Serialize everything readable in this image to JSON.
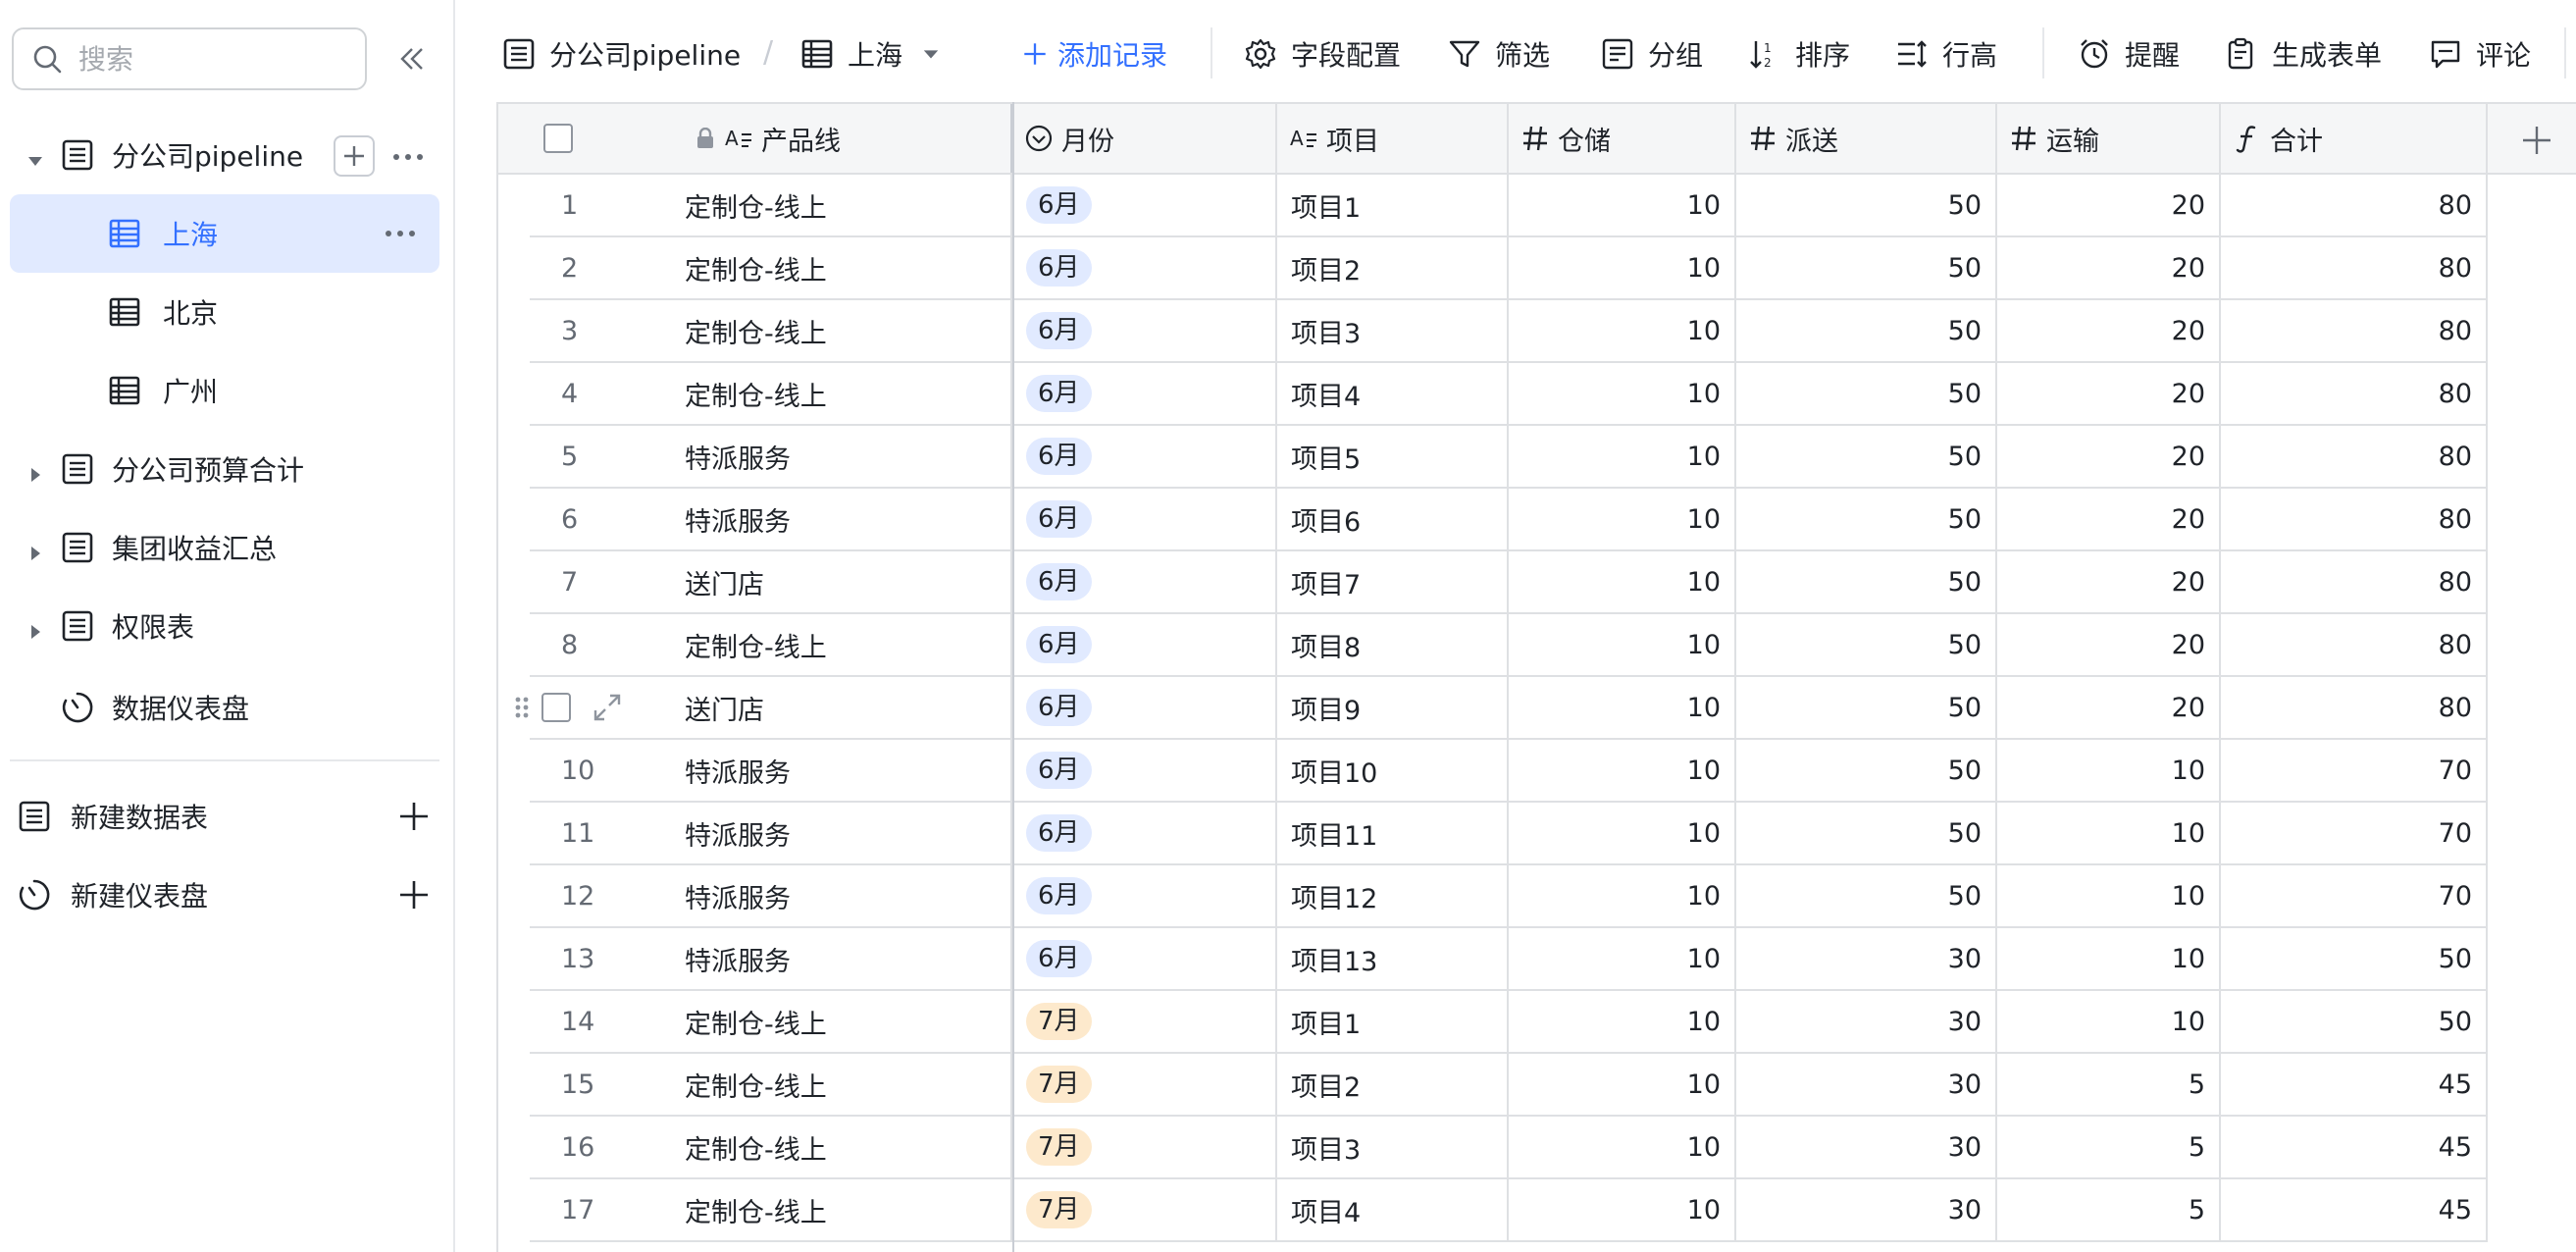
{
  "sidebar": {
    "search_placeholder": "搜索",
    "tree": [
      {
        "label": "分公司pipeline",
        "expanded": true,
        "children": [
          "上海",
          "北京",
          "广州"
        ]
      },
      {
        "label": "分公司预算合计"
      },
      {
        "label": "集团收益汇总"
      },
      {
        "label": "权限表"
      },
      {
        "label": "数据仪表盘"
      }
    ],
    "active_child": "上海",
    "create": [
      {
        "label": "新建数据表"
      },
      {
        "label": "新建仪表盘"
      }
    ]
  },
  "toolbar": {
    "base_title": "分公司pipeline",
    "view_name": "上海",
    "add_record": "添加记录",
    "field_config": "字段配置",
    "filter": "筛选",
    "group": "分组",
    "sort": "排序",
    "row_height": "行高",
    "remind": "提醒",
    "gen_form": "生成表单",
    "comment": "评论"
  },
  "table": {
    "columns": [
      "产品线",
      "月份",
      "项目",
      "仓储",
      "派送",
      "运输",
      "合计"
    ],
    "rows": [
      {
        "id": "1",
        "line": "定制仓-线上",
        "month": "6月",
        "project": "项目1",
        "storage": "10",
        "delivery": "50",
        "transport": "20",
        "total": "80"
      },
      {
        "id": "2",
        "line": "定制仓-线上",
        "month": "6月",
        "project": "项目2",
        "storage": "10",
        "delivery": "50",
        "transport": "20",
        "total": "80"
      },
      {
        "id": "3",
        "line": "定制仓-线上",
        "month": "6月",
        "project": "项目3",
        "storage": "10",
        "delivery": "50",
        "transport": "20",
        "total": "80"
      },
      {
        "id": "4",
        "line": "定制仓-线上",
        "month": "6月",
        "project": "项目4",
        "storage": "10",
        "delivery": "50",
        "transport": "20",
        "total": "80"
      },
      {
        "id": "5",
        "line": "特派服务",
        "month": "6月",
        "project": "项目5",
        "storage": "10",
        "delivery": "50",
        "transport": "20",
        "total": "80"
      },
      {
        "id": "6",
        "line": "特派服务",
        "month": "6月",
        "project": "项目6",
        "storage": "10",
        "delivery": "50",
        "transport": "20",
        "total": "80"
      },
      {
        "id": "7",
        "line": "送门店",
        "month": "6月",
        "project": "项目7",
        "storage": "10",
        "delivery": "50",
        "transport": "20",
        "total": "80"
      },
      {
        "id": "8",
        "line": "定制仓-线上",
        "month": "6月",
        "project": "项目8",
        "storage": "10",
        "delivery": "50",
        "transport": "20",
        "total": "80"
      },
      {
        "id": "",
        "line": "送门店",
        "month": "6月",
        "project": "项目9",
        "storage": "10",
        "delivery": "50",
        "transport": "20",
        "total": "80",
        "hover": true
      },
      {
        "id": "10",
        "line": "特派服务",
        "month": "6月",
        "project": "项目10",
        "storage": "10",
        "delivery": "50",
        "transport": "10",
        "total": "70"
      },
      {
        "id": "11",
        "line": "特派服务",
        "month": "6月",
        "project": "项目11",
        "storage": "10",
        "delivery": "50",
        "transport": "10",
        "total": "70"
      },
      {
        "id": "12",
        "line": "特派服务",
        "month": "6月",
        "project": "项目12",
        "storage": "10",
        "delivery": "50",
        "transport": "10",
        "total": "70"
      },
      {
        "id": "13",
        "line": "特派服务",
        "month": "6月",
        "project": "项目13",
        "storage": "10",
        "delivery": "30",
        "transport": "10",
        "total": "50"
      },
      {
        "id": "14",
        "line": "定制仓-线上",
        "month": "7月",
        "project": "项目1",
        "storage": "10",
        "delivery": "30",
        "transport": "10",
        "total": "50"
      },
      {
        "id": "15",
        "line": "定制仓-线上",
        "month": "7月",
        "project": "项目2",
        "storage": "10",
        "delivery": "30",
        "transport": "5",
        "total": "45"
      },
      {
        "id": "16",
        "line": "定制仓-线上",
        "month": "7月",
        "project": "项目3",
        "storage": "10",
        "delivery": "30",
        "transport": "5",
        "total": "45"
      },
      {
        "id": "17",
        "line": "定制仓-线上",
        "month": "7月",
        "project": "项目4",
        "storage": "10",
        "delivery": "30",
        "transport": "5",
        "total": "45"
      }
    ]
  },
  "colors": {
    "accent": "#3370ff",
    "active_bg": "#e1eaff",
    "pill_june": "#e1eaff",
    "pill_july": "#fde9cc",
    "header_bg": "#f5f6f7",
    "border": "#dee0e3"
  },
  "icons": {
    "search": "search-icon",
    "collapse": "double-chevron-left-icon",
    "table": "table-icon",
    "dashboard": "dashboard-icon",
    "plus": "plus-icon",
    "more": "more-icon",
    "caret_right": "caret-right-icon",
    "caret_down": "caret-down-icon"
  }
}
